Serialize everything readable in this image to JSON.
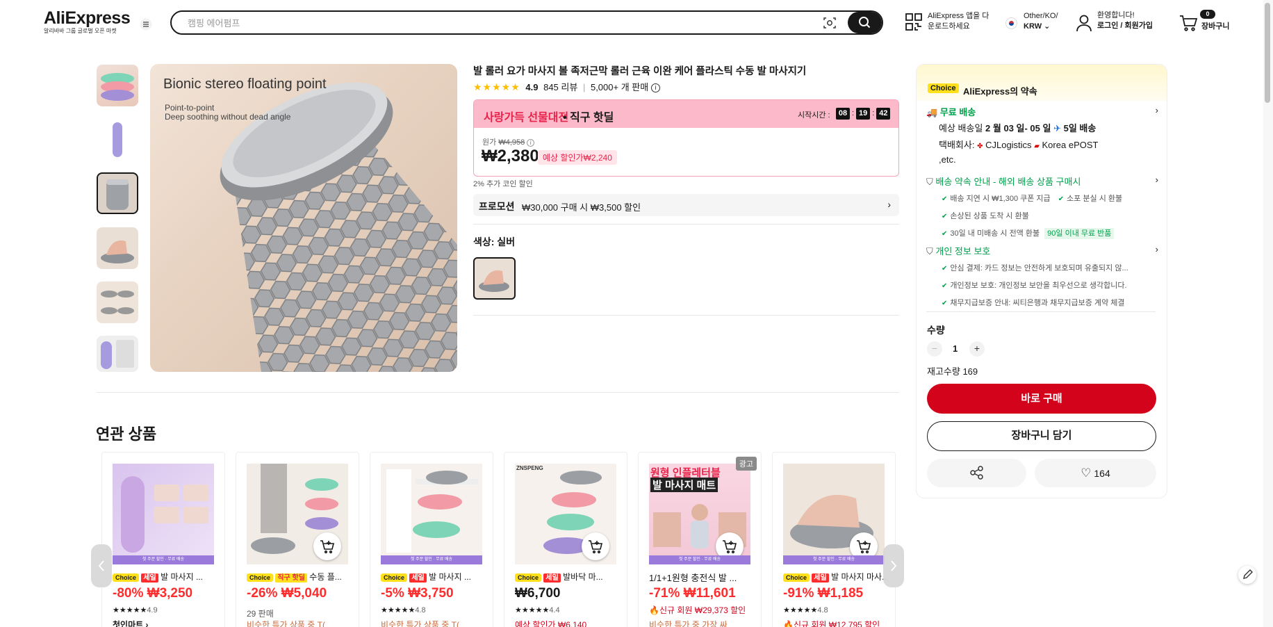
{
  "header": {
    "logo": "AliExpress",
    "logo_sub": "알리바바 그룹 글로벌 오픈 마켓",
    "search_placeholder": "캠핑 에어펌프",
    "app_line1": "AliExpress 앱을 다",
    "app_line2": "운로드하세요",
    "region_line1": "Other/KO/",
    "region_line2": "KRW",
    "user_line1": "환영합니다!",
    "user_line2": "로그인 / 회원가입",
    "cart_count": "0",
    "cart_label": "장바구니"
  },
  "gallery": {
    "headline": "Bionic stereo floating point",
    "sub1": "Point-to-point",
    "sub2": "Deep soothing without dead angle"
  },
  "product": {
    "title": "발 롤러 요가 마사지 볼 족저근막 롤러 근육 이완 케어 플라스틱 수동 발 마사지기",
    "rating": "4.9",
    "reviews": "845 리뷰",
    "sold": "5,000+ 개 판매",
    "deal_banner": "사랑가득 선물대전",
    "deal_label": "• 직구 핫딜",
    "start_label": "시작시간 :",
    "timer": [
      "08",
      "19",
      "42"
    ],
    "orig_label": "원가",
    "orig_price": "₩4,958",
    "price": "₩2,380",
    "est_price": "예상 할인가₩2,240",
    "coin_note": "2% 추가 코인 할인",
    "promo_tag": "프로모션",
    "promo_text": "₩30,000 구매 시 ₩3,500 할인",
    "color_label": "색상: 실버"
  },
  "panel": {
    "choice": "Choice",
    "promise": "AliExpress의 약속",
    "free_ship": "무료 배송",
    "eta_prefix": "예상 배송일",
    "eta_date": "2 월 03 일- 05 일",
    "eta_days": "5일 배송",
    "carrier": "택배회사:",
    "carrier1": "CJLogistics",
    "carrier2": "Korea",
    "carrier3": "ePOST ,etc.",
    "guarantee_title": "배송 약속 안내 - 해외 배송 상품 구매시",
    "g1": "배송 지연 시 ₩1,300 쿠폰 지급",
    "g2": "소포 분실 시 환불",
    "g3": "손상된 상품 도착 시 환불",
    "g4": "30일 내 미배송 시 전액 환불",
    "g5": "90일 이내 무료 반품",
    "privacy_title": "개인 정보 보호",
    "p1": "안심 결제: 카드 정보는 안전하게 보호되며 유출되지 않...",
    "p2": "개인정보 보호: 개인정보 보안을 최우선으로 생각합니다.",
    "p3": "채무지급보증 안내: 씨티은행과 채무지급보증 계약 체결",
    "qty_label": "수량",
    "qty": "1",
    "stock": "재고수량 169",
    "buy": "바로 구매",
    "add_cart": "장바구니 담기",
    "wish": "164"
  },
  "related": {
    "title": "연관 상품",
    "ad": "광고",
    "bar": "첫 주문 할인 · 무료 배송",
    "items": [
      {
        "choice": "Choice",
        "tag": "세일",
        "name": "발 마사지 ...",
        "price": "-80% ₩3,250",
        "rating": "4.9",
        "extra": "첫인마트 ›"
      },
      {
        "choice": "Choice",
        "tag": "직구 핫딜",
        "name": "수동 플...",
        "price": "-26% ₩5,040",
        "rating": "",
        "extra": "29 판매"
      },
      {
        "choice": "Choice",
        "tag": "세일",
        "name": "발 마사지 ...",
        "price": "-5% ₩3,750",
        "rating": "4.8",
        "extra": "비슷한 특가 상품 중 T("
      },
      {
        "choice": "Choice",
        "tag": "세일",
        "name": "발바닥 마...",
        "price": "₩6,700",
        "rating": "4.4",
        "extra": "예상 할인가 ₩6,140"
      },
      {
        "choice": "",
        "tag": "",
        "name": "1/1+1원형 충전식 발 ...",
        "price": "-71% ₩11,601",
        "rating": "",
        "extra": "신규 회원 ₩29,373 할인"
      },
      {
        "choice": "Choice",
        "tag": "세일",
        "name": "발 마사지 마사...",
        "price": "-91% ₩1,185",
        "rating": "4.8",
        "extra": "신규 회원 ₩12,795 할인"
      }
    ],
    "extra2": [
      "비슷한 특가 상품 중 T(",
      "비슷한 특가 중 가장 싸"
    ],
    "promo_overlay": "원형 인플레터블",
    "promo_overlay2": "발 마사지 매트"
  }
}
